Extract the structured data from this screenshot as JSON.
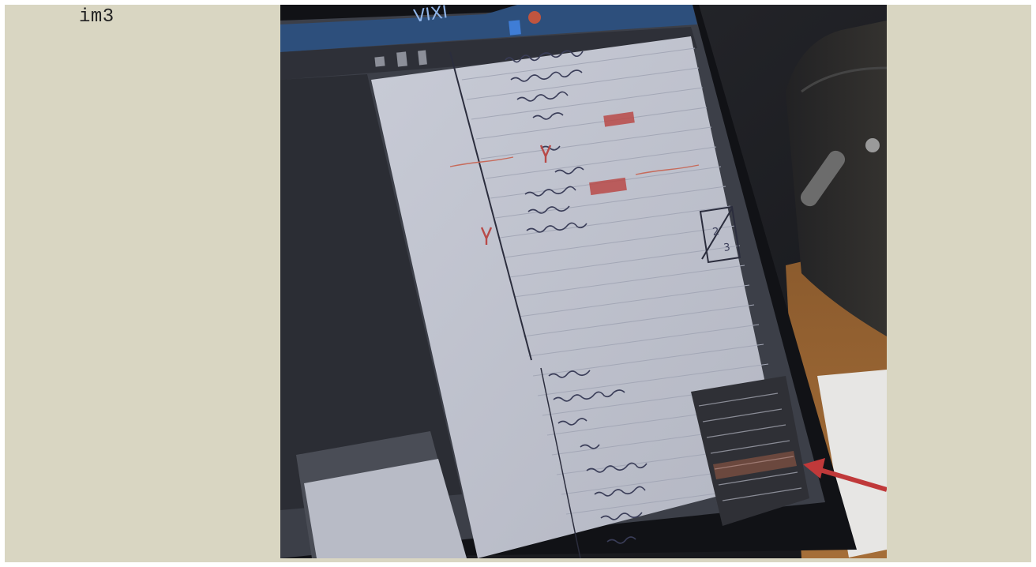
{
  "caption": "im3",
  "photo": {
    "description_icon": "photo-of-laptop-screen",
    "colors": {
      "page_bg": "#d9d6c2",
      "screen_paper": "#bfc2cc",
      "ink": "#3a3d58",
      "red_mark": "#b84a48",
      "arrow": "#c0393a"
    }
  }
}
